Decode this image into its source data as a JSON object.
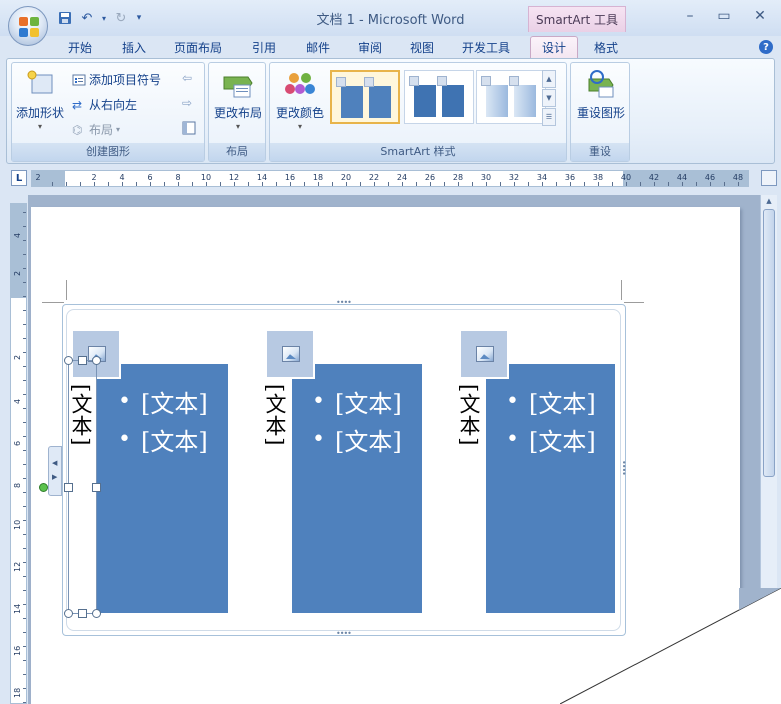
{
  "app": {
    "window_title": "文档 1 - Microsoft Word",
    "contextual_tab_group": "SmartArt 工具"
  },
  "tabs": [
    "开始",
    "插入",
    "页面布局",
    "引用",
    "邮件",
    "审阅",
    "视图",
    "开发工具",
    "设计",
    "格式"
  ],
  "active_tab": "设计",
  "ribbon": {
    "create_graphic": {
      "label": "创建图形",
      "add_shape": "添加形状",
      "add_bullet": "添加项目符号",
      "right_to_left": "从右向左",
      "layout": "布局"
    },
    "layouts": {
      "label": "布局",
      "change_layout": "更改布局"
    },
    "smartart_styles": {
      "label": "SmartArt 样式",
      "change_colors": "更改颜色"
    },
    "reset": {
      "label": "重设",
      "reset_graphic": "重设图形"
    }
  },
  "ruler": {
    "horizontal_numbers": [
      "2",
      "2",
      "4",
      "6",
      "8",
      "10",
      "12",
      "14",
      "16",
      "18",
      "20",
      "22",
      "24",
      "26",
      "28",
      "30",
      "32",
      "34",
      "36",
      "38",
      "40",
      "42",
      "44",
      "46",
      "48"
    ],
    "vertical_numbers": [
      "4",
      "2",
      "2",
      "4",
      "6",
      "8",
      "10",
      "12",
      "14",
      "16",
      "18"
    ]
  },
  "smartart": {
    "columns": [
      {
        "vertical_text": "[文本]",
        "bullets": [
          "[文本]",
          "[文本]"
        ]
      },
      {
        "vertical_text": "[文本]",
        "bullets": [
          "[文本]",
          "[文本]"
        ]
      },
      {
        "vertical_text": "[文本]",
        "bullets": [
          "[文本]",
          "[文本]"
        ]
      }
    ]
  },
  "colors": {
    "accent_blue": "#4f81bd",
    "ribbon_text": "#15428b",
    "contextual_tab": "#ead0e6"
  },
  "icons": {
    "office_button": "office-logo-icon",
    "save": "save-icon",
    "undo": "undo-icon",
    "redo": "redo-icon",
    "picture_placeholder": "picture-icon"
  }
}
